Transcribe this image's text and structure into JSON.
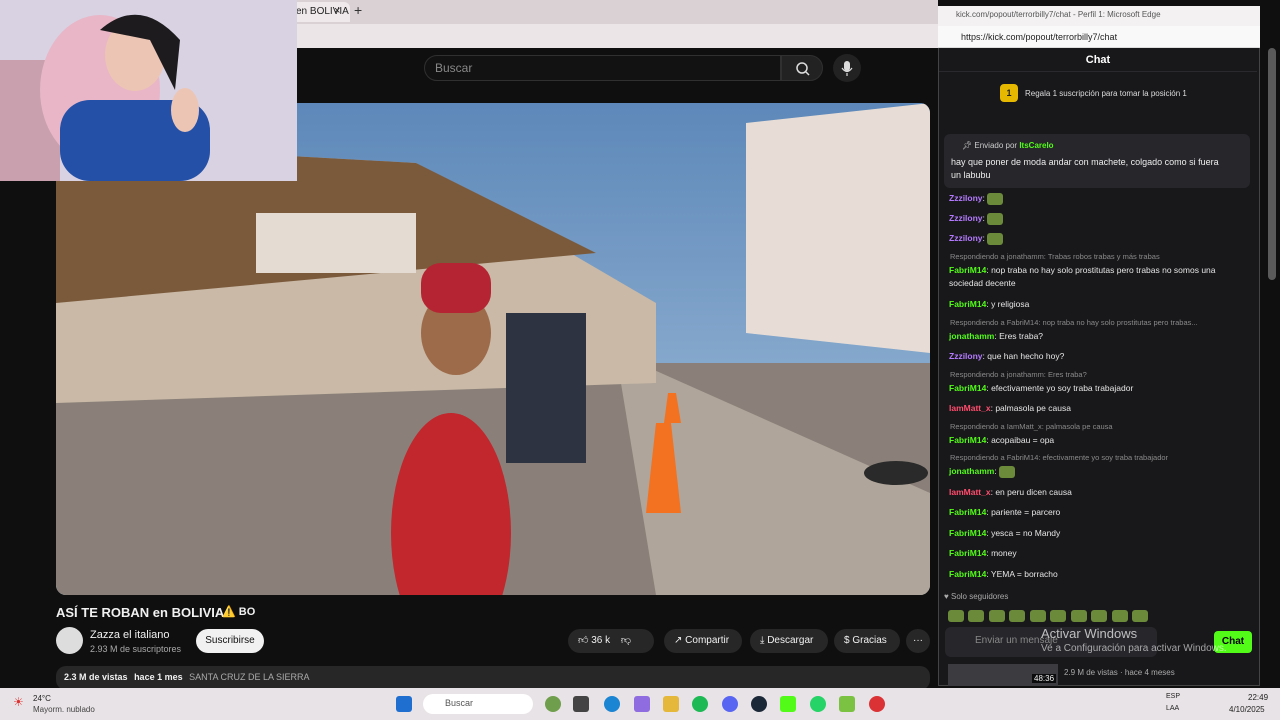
{
  "browser": {
    "tab_label": "en BOLIVIA",
    "tab_close": "×",
    "new_tab": "+"
  },
  "youtube": {
    "search_placeholder": "Buscar",
    "video_title": "ASÍ TE ROBAN en BOLIVIA",
    "title_suffix": "⚠️ BO",
    "channel_name": "Zazza el italiano",
    "channel_subs": "2.93 M de suscriptores",
    "subscribe_label": "Suscribirse",
    "like_count": "36 k",
    "share_label": "Compartir",
    "download_label": "Descargar",
    "thanks_label": "Gracias",
    "more_label": "···",
    "views": "2.3 M de vistas",
    "published": "hace 1 mes",
    "location": "SANTA CRUZ DE LA SIERRA"
  },
  "chat_window": {
    "title": "kick.com/popout/terrorbilly7/chat - Perfil 1: Microsoft Edge",
    "url": "https://kick.com/popout/terrorbilly7/chat",
    "header": "Chat",
    "gift_banner": "Regala 1 suscripción para tomar la posición 1",
    "gift_position": "1",
    "pinned_prefix": "Enviado por",
    "pinned_user": "ItsCarelo",
    "pinned_text": "hay que poner de moda andar con machete, colgado como si fuera un labubu",
    "messages": [
      {
        "type": "msg",
        "user": "Zzzilony",
        "user_color": "purple",
        "text": "",
        "emote": true
      },
      {
        "type": "msg",
        "user": "Zzzilony",
        "user_color": "purple",
        "text": "",
        "emote": true
      },
      {
        "type": "msg",
        "user": "Zzzilony",
        "user_color": "purple",
        "text": "",
        "emote": true
      },
      {
        "type": "reply",
        "text": "Respondiendo a jonathamm: Trabas robos trabas y más trabas"
      },
      {
        "type": "msg",
        "user": "FabriM14",
        "user_color": "green",
        "text": "nop traba no hay solo prostitutas pero trabas no somos una sociedad decente"
      },
      {
        "type": "msg",
        "user": "FabriM14",
        "user_color": "green",
        "text": "y religiosa"
      },
      {
        "type": "reply",
        "text": "Respondiendo a FabriM14: nop traba no hay solo prostitutas pero trabas..."
      },
      {
        "type": "msg",
        "user": "jonathamm",
        "user_color": "green",
        "text": "Eres traba?"
      },
      {
        "type": "msg",
        "user": "Zzzilony",
        "user_color": "purple",
        "text": "que han hecho hoy?"
      },
      {
        "type": "reply",
        "text": "Respondiendo a jonathamm: Eres traba?"
      },
      {
        "type": "msg",
        "user": "FabriM14",
        "user_color": "green",
        "text": "efectivamente yo soy traba trabajador"
      },
      {
        "type": "msg",
        "user": "IamMatt_x",
        "user_color": "red",
        "text": "palmasola pe causa"
      },
      {
        "type": "reply",
        "text": "Respondiendo a IamMatt_x: palmasola pe causa"
      },
      {
        "type": "msg",
        "user": "FabriM14",
        "user_color": "green",
        "text": "acopaibau = opa"
      },
      {
        "type": "reply",
        "text": "Respondiendo a FabriM14: efectivamente yo soy traba trabajador"
      },
      {
        "type": "msg",
        "user": "jonathamm",
        "user_color": "green",
        "text": "",
        "emote": true
      },
      {
        "type": "msg",
        "user": "IamMatt_x",
        "user_color": "red",
        "text": "en peru dicen causa"
      },
      {
        "type": "msg",
        "user": "FabriM14",
        "user_color": "green",
        "text": "pariente = parcero"
      },
      {
        "type": "msg",
        "user": "FabriM14",
        "user_color": "green",
        "text": "yesca = no Mandy"
      },
      {
        "type": "msg",
        "user": "FabriM14",
        "user_color": "green",
        "text": "money"
      },
      {
        "type": "msg",
        "user": "FabriM14",
        "user_color": "green",
        "text": "YEMA = borracho"
      }
    ],
    "followers_only": "Solo seguidores",
    "input_placeholder": "Enviar un mensaje",
    "send_label": "Chat",
    "side_duration": "48:36",
    "side_meta": "2.9 M de vistas  ·  hace 4 meses"
  },
  "watermark": {
    "title": "Activar Windows",
    "subtitle": "Ve a Configuración para activar Windows."
  },
  "taskbar": {
    "temp": "24°C",
    "weather": "Mayorm. nublado",
    "search": "Buscar",
    "lang1": "ESP",
    "lang2": "LAA",
    "time": "22:49",
    "date": "4/10/2025"
  }
}
